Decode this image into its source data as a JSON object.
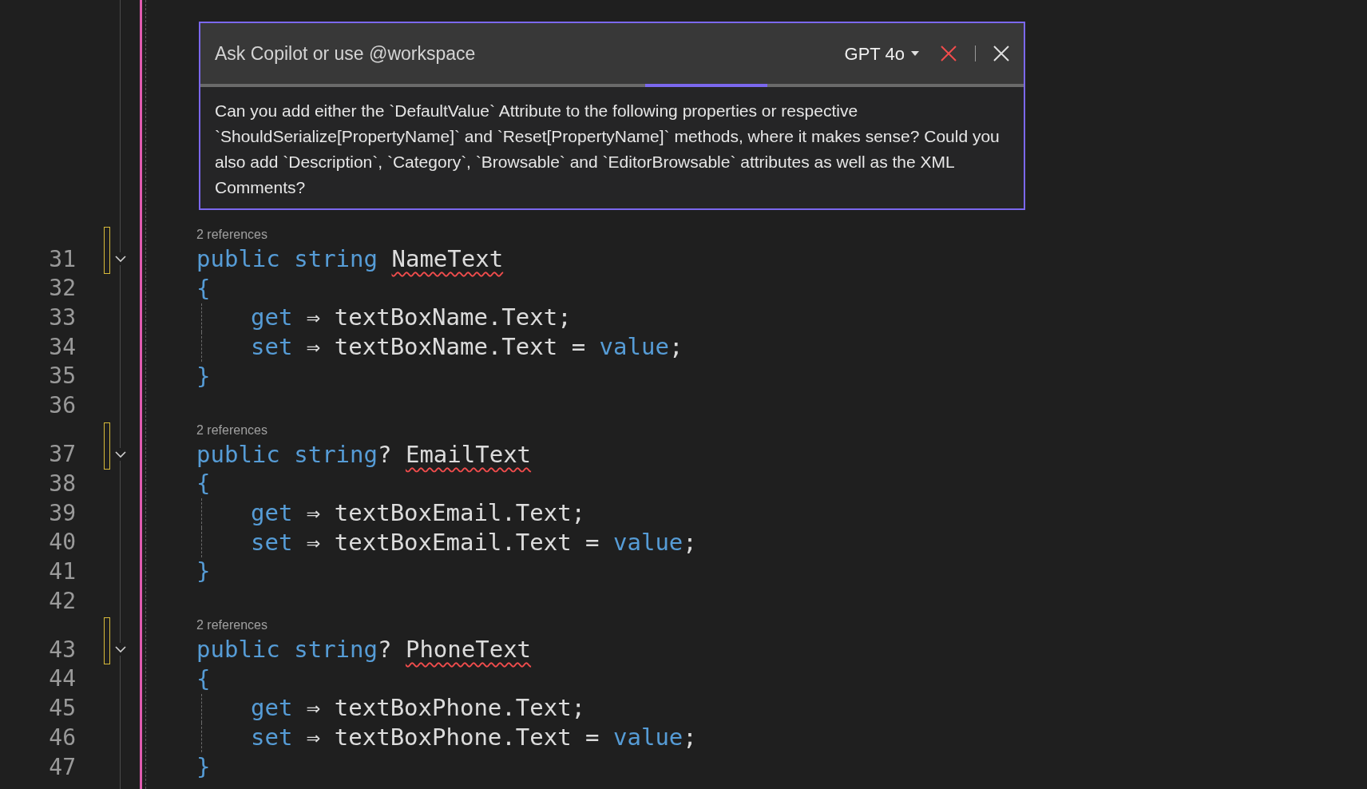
{
  "copilot": {
    "placeholder": "Ask Copilot or use @workspace",
    "model": "GPT 4o",
    "prompt": "Can you add either the `DefaultValue` Attribute to the following properties or respective `ShouldSerialize[PropertyName]` and `Reset[PropertyName]` methods, where it makes sense? Could you also add `Description`, `Category`, `Browsable` and `EditorBrowsable` attributes as well as the XML Comments?"
  },
  "editor": {
    "blocks": [
      {
        "references": "2 references",
        "modified": true,
        "expanded": true,
        "lines": [
          {
            "number": "31",
            "words": [
              [
                {
                  "kind": "keyword",
                  "text": "public"
                }
              ],
              [
                {
                  "kind": "keyword",
                  "text": "string"
                }
              ],
              [
                {
                  "kind": "error",
                  "text": "NameText"
                }
              ]
            ]
          },
          {
            "number": "32",
            "words": [
              [
                {
                  "kind": "brace",
                  "text": "{"
                }
              ]
            ],
            "children": [
              {
                "number": "33",
                "words": [
                  [
                    {
                      "kind": "keyword",
                      "text": "get"
                    }
                  ],
                  [
                    {
                      "kind": "plain",
                      "text": "⇒"
                    }
                  ],
                  [
                    {
                      "kind": "plain",
                      "text": "textBoxName.Text;"
                    }
                  ]
                ]
              },
              {
                "number": "34",
                "words": [
                  [
                    {
                      "kind": "keyword",
                      "text": "set"
                    }
                  ],
                  [
                    {
                      "kind": "plain",
                      "text": "⇒"
                    }
                  ],
                  [
                    {
                      "kind": "plain",
                      "text": "textBoxName.Text"
                    }
                  ],
                  [
                    {
                      "kind": "plain",
                      "text": "="
                    }
                  ],
                  [
                    {
                      "kind": "keyword",
                      "text": "value"
                    },
                    {
                      "kind": "plain",
                      "text": ";"
                    }
                  ]
                ]
              }
            ]
          },
          {
            "number": "35",
            "words": [
              [
                {
                  "kind": "brace",
                  "text": "}"
                }
              ]
            ]
          },
          {
            "number": "36"
          }
        ]
      },
      {
        "references": "2 references",
        "modified": true,
        "expanded": true,
        "lines": [
          {
            "number": "37",
            "words": [
              [
                {
                  "kind": "keyword",
                  "text": "public"
                }
              ],
              [
                {
                  "kind": "keyword",
                  "text": "string"
                },
                {
                  "kind": "plain",
                  "text": "?"
                }
              ],
              [
                {
                  "kind": "error",
                  "text": "EmailText"
                }
              ]
            ]
          },
          {
            "number": "38",
            "words": [
              [
                {
                  "kind": "brace",
                  "text": "{"
                }
              ]
            ],
            "children": [
              {
                "number": "39",
                "words": [
                  [
                    {
                      "kind": "keyword",
                      "text": "get"
                    }
                  ],
                  [
                    {
                      "kind": "plain",
                      "text": "⇒"
                    }
                  ],
                  [
                    {
                      "kind": "plain",
                      "text": "textBoxEmail.Text;"
                    }
                  ]
                ]
              },
              {
                "number": "40",
                "words": [
                  [
                    {
                      "kind": "keyword",
                      "text": "set"
                    }
                  ],
                  [
                    {
                      "kind": "plain",
                      "text": "⇒"
                    }
                  ],
                  [
                    {
                      "kind": "plain",
                      "text": "textBoxEmail.Text"
                    }
                  ],
                  [
                    {
                      "kind": "plain",
                      "text": "="
                    }
                  ],
                  [
                    {
                      "kind": "keyword",
                      "text": "value"
                    },
                    {
                      "kind": "plain",
                      "text": ";"
                    }
                  ]
                ]
              }
            ]
          },
          {
            "number": "41",
            "words": [
              [
                {
                  "kind": "brace",
                  "text": "}"
                }
              ]
            ]
          },
          {
            "number": "42"
          }
        ]
      },
      {
        "references": "2 references",
        "modified": true,
        "expanded": true,
        "lines": [
          {
            "number": "43",
            "words": [
              [
                {
                  "kind": "keyword",
                  "text": "public"
                }
              ],
              [
                {
                  "kind": "keyword",
                  "text": "string"
                },
                {
                  "kind": "plain",
                  "text": "?"
                }
              ],
              [
                {
                  "kind": "error",
                  "text": "PhoneText"
                }
              ]
            ]
          },
          {
            "number": "44",
            "words": [
              [
                {
                  "kind": "brace",
                  "text": "{"
                }
              ]
            ],
            "children": [
              {
                "number": "45",
                "words": [
                  [
                    {
                      "kind": "keyword",
                      "text": "get"
                    }
                  ],
                  [
                    {
                      "kind": "plain",
                      "text": "⇒"
                    }
                  ],
                  [
                    {
                      "kind": "plain",
                      "text": "textBoxPhone.Text;"
                    }
                  ]
                ]
              },
              {
                "number": "46",
                "words": [
                  [
                    {
                      "kind": "keyword",
                      "text": "set"
                    }
                  ],
                  [
                    {
                      "kind": "plain",
                      "text": "⇒"
                    }
                  ],
                  [
                    {
                      "kind": "plain",
                      "text": "textBoxPhone.Text"
                    }
                  ],
                  [
                    {
                      "kind": "plain",
                      "text": "="
                    }
                  ],
                  [
                    {
                      "kind": "keyword",
                      "text": "value"
                    },
                    {
                      "kind": "plain",
                      "text": ";"
                    }
                  ]
                ]
              }
            ]
          },
          {
            "number": "47",
            "words": [
              [
                {
                  "kind": "brace",
                  "text": "}"
                }
              ]
            ]
          }
        ]
      }
    ]
  }
}
